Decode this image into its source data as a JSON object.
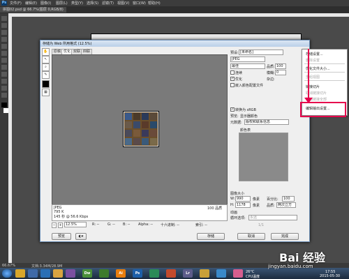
{
  "ps": {
    "logo": "Ps",
    "menus": [
      "文件(F)",
      "编辑(E)",
      "图像(I)",
      "图层(L)",
      "类型(Y)",
      "选择(S)",
      "滤镜(T)",
      "视图(V)",
      "窗口(W)",
      "帮助(H)"
    ],
    "doc_tab": "拼图02.psd @ 66.7%(图层 0,RGB/8)",
    "status_zoom": "66.67%",
    "status_doc": "文档:3.34M/28.9M"
  },
  "dialog": {
    "title": "存储为 Web 所用格式 (12.5%)",
    "view_tabs": [
      "原稿",
      "优化",
      "双联",
      "四联"
    ],
    "active_tab": "优化",
    "preview_info": {
      "format": "JPEG",
      "size": "795 K",
      "time": "145 秒 @ 56.6 Kbps",
      "quality": "100 品质"
    },
    "status": {
      "zoom": "12.5%",
      "r": "R: --",
      "g": "G: --",
      "b": "B: --",
      "alpha": "Alpha: --",
      "hex": "十六进制: --",
      "index": "索引: --"
    },
    "buttons": {
      "preview": "预览",
      "save": "存储",
      "cancel": "取消",
      "done": "完成"
    },
    "settings": {
      "preset_label": "预设:",
      "preset_value": "[未命名]",
      "format_value": "JPEG",
      "quality_mode": "最佳",
      "quality_label": "品质:",
      "quality_value": "100",
      "progressive_label": "连续",
      "blur_label": "模糊:",
      "blur_value": "0",
      "optimized_label": "优化",
      "matte_label": "杂边:",
      "embed_profile_label": "嵌入颜色配置文件",
      "convert_srgb_label": "转换为 sRGB",
      "preview_label": "预览:",
      "preview_value": "显示器颜色",
      "metadata_label": "元数据:",
      "metadata_value": "版权和联系信息",
      "color_table_label": "颜色表"
    },
    "image_size": {
      "label": "图像大小",
      "w_label": "W:",
      "w_value": "990",
      "h_label": "H:",
      "h_value": "1178",
      "unit": "像素",
      "percent_label": "百分比:",
      "percent_value": "100",
      "quality_label": "品质:",
      "quality_value": "两次立方"
    },
    "animation": {
      "label": "动画",
      "loop_label": "循环选项:",
      "loop_value": "永远",
      "frame": "1/1"
    }
  },
  "flyout": {
    "items": [
      {
        "label": "存储设置...",
        "disabled": false
      },
      {
        "label": "删除设置",
        "disabled": true
      },
      {
        "label": "优化文件大小...",
        "disabled": false
      },
      {
        "label": "重组视图",
        "disabled": true
      },
      {
        "label": "链接切片",
        "disabled": false
      },
      {
        "label": "取消链接切片",
        "disabled": true
      },
      {
        "label": "取消链接全部",
        "disabled": true
      },
      {
        "label": "编辑输出设置...",
        "disabled": false
      }
    ]
  },
  "taskbar": {
    "apps": [
      {
        "icon": "dreamweaver-icon",
        "label": "Dw",
        "color": "#4a8f3a"
      },
      {
        "icon": "illustrator-icon",
        "label": "Ai",
        "color": "#e87d0d"
      },
      {
        "icon": "photoshop-icon",
        "label": "Ps",
        "color": "#1e5fa8"
      },
      {
        "icon": "lightroom-icon",
        "label": "Lr",
        "color": "#5c5c8a"
      }
    ],
    "weather": "26°C",
    "weather_note": "CPU温度",
    "time": "17:55",
    "date": "2015-05-30"
  },
  "watermark": {
    "text": "Bai 经验",
    "url": "jingyan.baidu.com"
  },
  "colors": {
    "accent": "#e6004c"
  }
}
